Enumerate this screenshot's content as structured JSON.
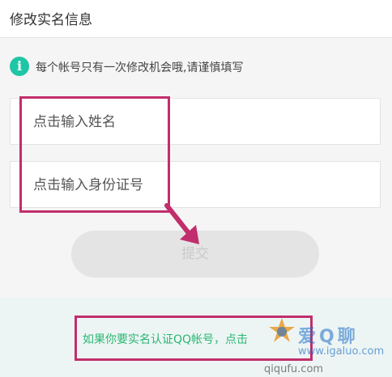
{
  "header": {
    "title": "修改实名信息"
  },
  "notice": {
    "icon": "info-icon",
    "icon_glyph": "i",
    "text": "每个帐号只有一次修改机会哦,请谨慎填写"
  },
  "form": {
    "name_placeholder": "点击输入姓名",
    "id_placeholder": "点击输入身份证号",
    "submit_label": "提交"
  },
  "footer": {
    "link_text": "如果你要实名认证QQ帐号，点击"
  },
  "watermark": {
    "text": "爱Q聊",
    "url": "www.igaluo.com",
    "domain": "qiqufu.com"
  },
  "colors": {
    "accent": "#1fc6a5",
    "highlight": "#c12e6c",
    "link": "#2bb673"
  }
}
